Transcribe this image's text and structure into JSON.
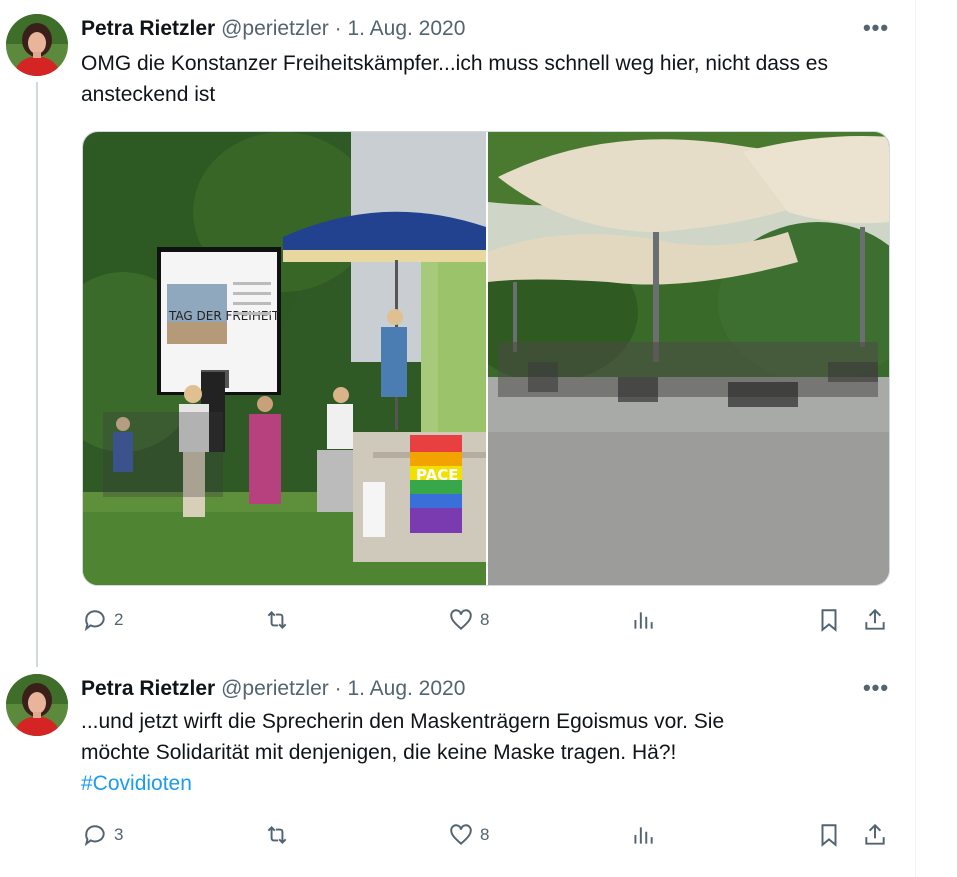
{
  "tweets": [
    {
      "author_name": "Petra Rietzler",
      "handle": "@perietzler",
      "separator": "·",
      "date": "1. Aug. 2020",
      "text": "OMG die Konstanzer Freiheitskämpfer...ich muss schnell weg hier, nicht dass es ansteckend ist",
      "media": {
        "count": 2,
        "image1": {
          "screen_text": "TAG DER FREIHEIT",
          "banner_text": "PACE"
        }
      },
      "stats": {
        "replies": "2",
        "likes": "8"
      }
    },
    {
      "author_name": "Petra Rietzler",
      "handle": "@perietzler",
      "separator": "·",
      "date": "1. Aug. 2020",
      "text_lines": [
        "...und jetzt wirft die Sprecherin den Maskenträgern Egoismus vor. Sie",
        "möchte Solidarität mit denjenigen, die keine Maske tragen. Hä?!"
      ],
      "hashtag": "#Covidioten",
      "stats": {
        "replies": "3",
        "likes": "8"
      }
    }
  ],
  "icons": [
    "more-icon",
    "reply-icon",
    "retweet-icon",
    "like-icon",
    "views-icon",
    "bookmark-icon",
    "share-icon"
  ],
  "colors": {
    "text": "#0f1419",
    "secondary": "#536471",
    "link": "#1d9bf0",
    "border": "#cfd9de"
  }
}
